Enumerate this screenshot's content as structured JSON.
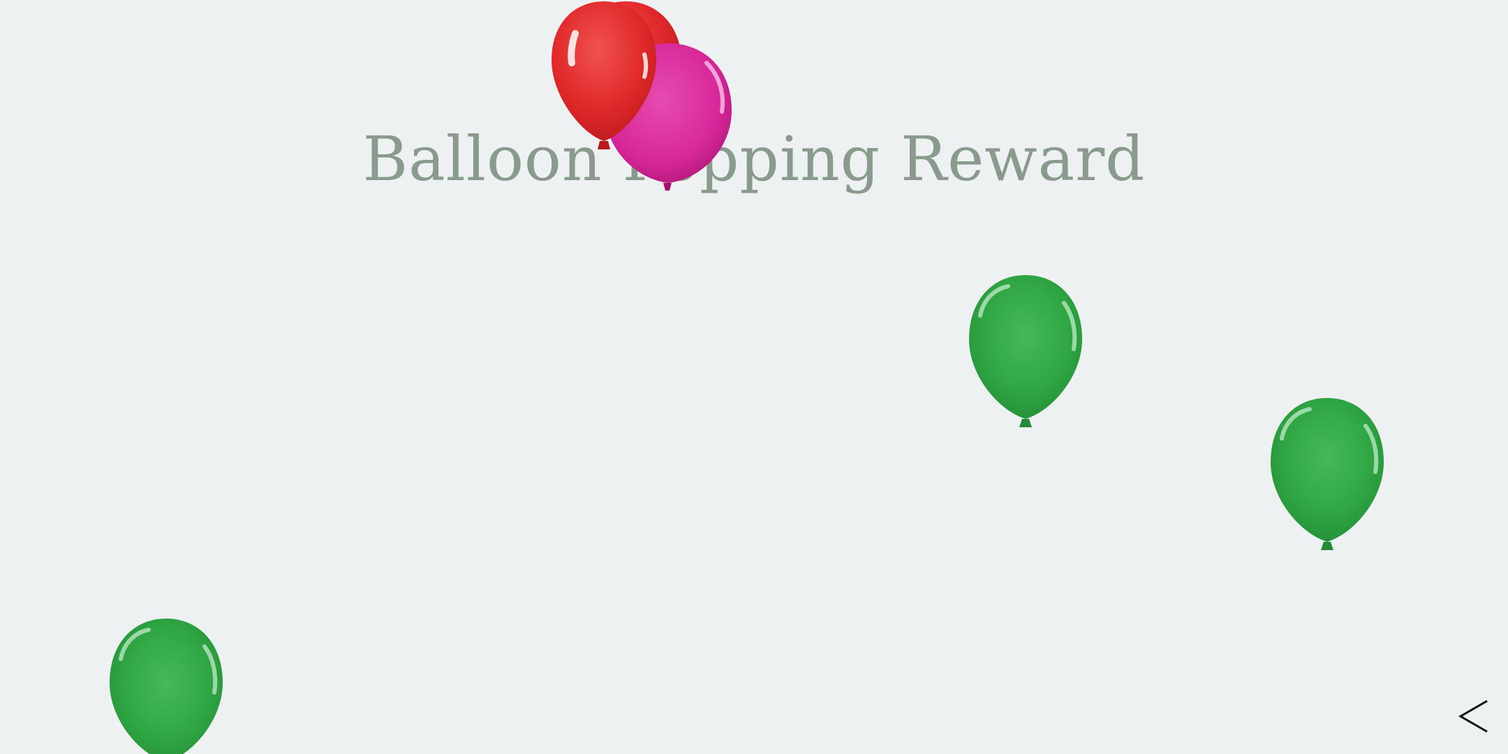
{
  "screen": {
    "title": "Balloon Popping Reward"
  },
  "colors": {
    "background": "#edf1f2",
    "title_text": "#8a9a8c",
    "balloon_red": "#e0282a",
    "balloon_pink": "#d8279a",
    "balloon_green": "#2fa643",
    "back_icon": "#111111"
  },
  "balloons": [
    {
      "name": "balloon-red-back",
      "color": "red"
    },
    {
      "name": "balloon-red-front",
      "color": "red"
    },
    {
      "name": "balloon-pink",
      "color": "pink"
    },
    {
      "name": "balloon-green",
      "color": "green"
    },
    {
      "name": "balloon-green",
      "color": "green"
    },
    {
      "name": "balloon-green",
      "color": "green"
    }
  ],
  "navigation": {
    "back_icon": "chevron-left-icon"
  }
}
